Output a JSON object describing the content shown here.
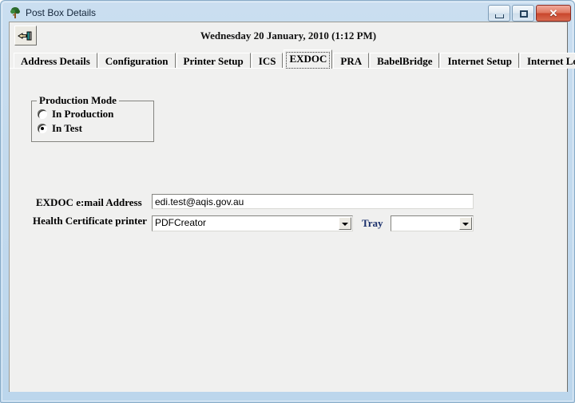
{
  "window": {
    "title": "Post Box Details",
    "icon": "tree-icon",
    "controls": {
      "minimize": "minimize-icon",
      "maximize": "maximize-icon",
      "close_label": "✕"
    },
    "frame_color": "#c3daee",
    "client_color": "#f0f0ef"
  },
  "toolbar": {
    "exit_button_icon": "pointing-hand-exit-icon",
    "datetime": "Wednesday 20 January, 2010  (1:12 PM)"
  },
  "tabs": [
    {
      "label": "Address Details",
      "selected": false
    },
    {
      "label": "Configuration",
      "selected": false
    },
    {
      "label": "Printer Setup",
      "selected": false
    },
    {
      "label": "ICS",
      "selected": false
    },
    {
      "label": "EXDOC",
      "selected": true
    },
    {
      "label": "PRA",
      "selected": false
    },
    {
      "label": "BabelBridge",
      "selected": false
    },
    {
      "label": "Internet Setup",
      "selected": false
    },
    {
      "label": "Internet Logs",
      "selected": false
    }
  ],
  "exdoc_panel": {
    "production_mode": {
      "legend": "Production Mode",
      "options": [
        {
          "label": "In Production",
          "checked": false
        },
        {
          "label": "In Test",
          "checked": true
        }
      ]
    },
    "email": {
      "label": "EXDOC e:mail Address",
      "value": "edi.test@aqis.gov.au"
    },
    "printer": {
      "label": "Health Certificate printer",
      "value": "PDFCreator"
    },
    "tray": {
      "label": "Tray",
      "value": "",
      "label_color": "#1a2f6b"
    }
  }
}
